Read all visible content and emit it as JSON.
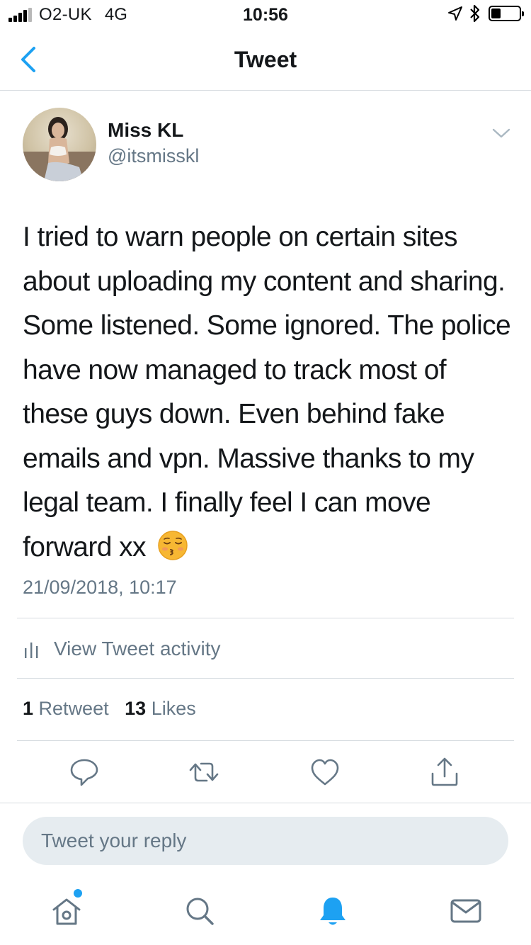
{
  "status_bar": {
    "carrier": "O2-UK",
    "network": "4G",
    "time": "10:56",
    "signal_bars": 4,
    "icons": [
      "location-icon",
      "bluetooth-icon",
      "battery-icon"
    ],
    "battery_level": 0.35
  },
  "nav": {
    "back_icon": "chevron-left-icon",
    "title": "Tweet"
  },
  "tweet": {
    "author": {
      "display_name": "Miss KL",
      "handle": "@itsmisskl"
    },
    "text": "I tried to warn people on certain sites about uploading my content and sharing. Some listened. Some ignored. The police have now managed to track most of these guys down. Even behind fake emails and vpn. Massive thanks to my legal team. I finally feel I can move forward xx",
    "emoji": "kissing-face-emoji",
    "timestamp": "21/09/2018, 10:17",
    "activity_label": "View Tweet activity",
    "retweet_count": "1",
    "retweet_label": "Retweet",
    "like_count": "13",
    "like_label": "Likes"
  },
  "actions": [
    "reply-icon",
    "retweet-icon",
    "like-icon",
    "share-icon"
  ],
  "reply_box": {
    "placeholder": "Tweet your reply"
  },
  "tabbar": {
    "tabs": [
      "home-icon",
      "search-icon",
      "notifications-icon",
      "messages-icon"
    ],
    "active": "notifications-icon"
  },
  "colors": {
    "accent": "#1da1f2",
    "secondary_text": "#657786",
    "divider": "#d6dbe0",
    "input_bg": "#e6ecf0"
  }
}
